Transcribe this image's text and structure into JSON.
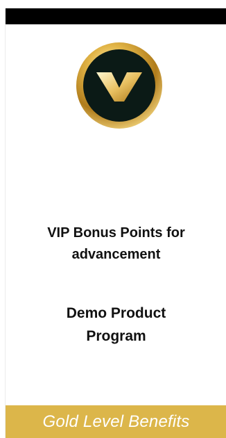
{
  "colors": {
    "top_bar": "#000000",
    "gold_accent": "#dcb64a",
    "logo_ring": "#c99a2e",
    "logo_inner": "#0b1a16",
    "text": "#111111"
  },
  "logo": {
    "icon": "vip-v-emblem-icon"
  },
  "card": {
    "headline_line1": "VIP Bonus Points for",
    "headline_line2": "advancement",
    "program_line1": "Demo Product",
    "program_line2": "Program"
  },
  "footer": {
    "label": "Gold Level Benefits"
  }
}
